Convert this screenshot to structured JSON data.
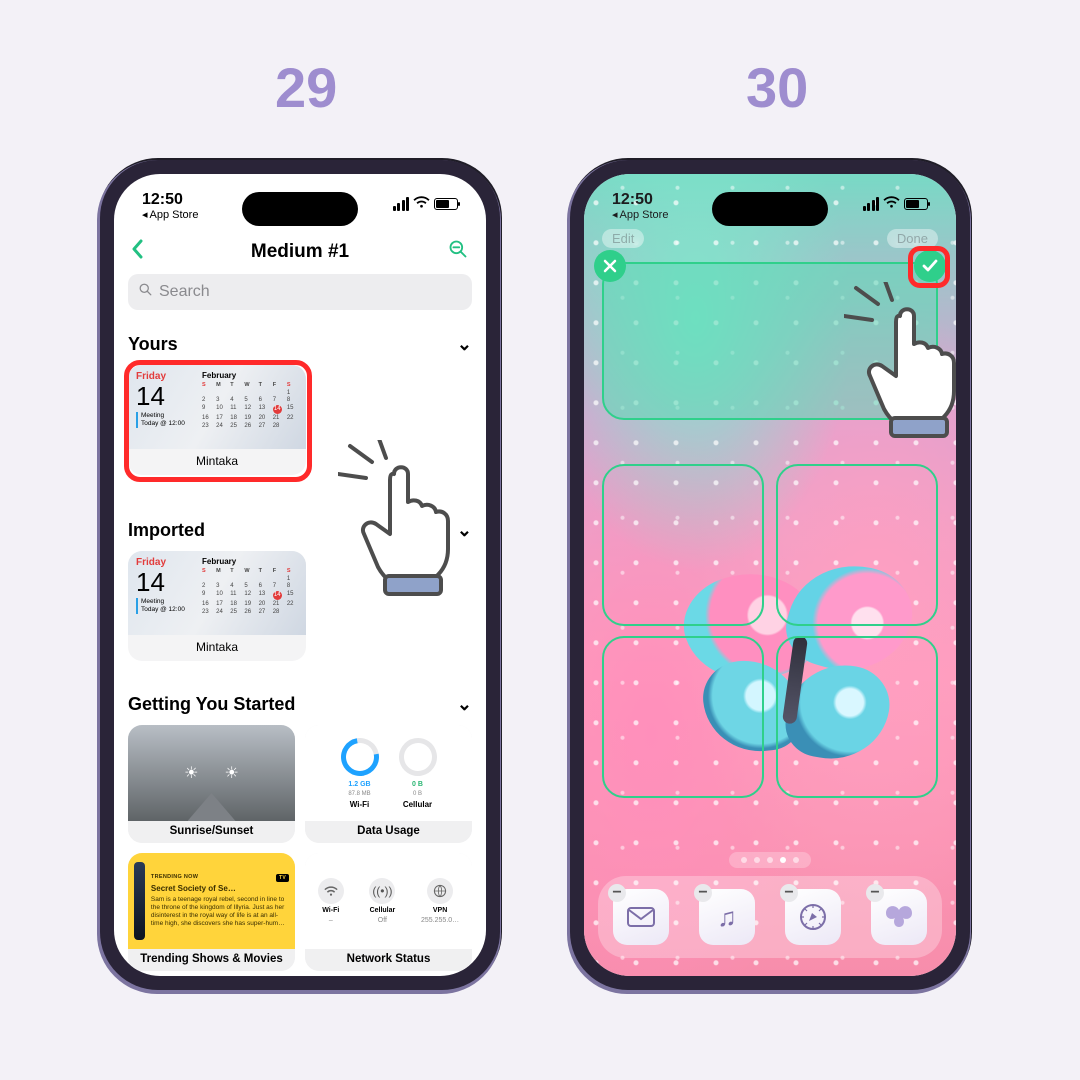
{
  "steps": {
    "left": "29",
    "right": "30"
  },
  "status": {
    "time": "12:50",
    "back_label": "App Store"
  },
  "left_screen": {
    "nav_title": "Medium #1",
    "search_placeholder": "Search",
    "sections": {
      "yours": "Yours",
      "imported": "Imported",
      "started": "Getting You Started"
    },
    "widget": {
      "day_name": "Friday",
      "month": "February",
      "date": "14",
      "event_title": "Meeting",
      "event_time": "Today @ 12:00",
      "label": "Mintaka",
      "dow": [
        "S",
        "M",
        "T",
        "W",
        "T",
        "F",
        "S"
      ],
      "days": [
        "",
        "",
        "",
        "",
        "",
        "",
        "1",
        "2",
        "3",
        "4",
        "5",
        "6",
        "7",
        "8",
        "9",
        "10",
        "11",
        "12",
        "13",
        "14",
        "15",
        "16",
        "17",
        "18",
        "19",
        "20",
        "21",
        "22",
        "23",
        "24",
        "25",
        "26",
        "27",
        "28"
      ]
    },
    "gs": {
      "sun": "Sunrise/Sunset",
      "data": "Data Usage",
      "data_wifi_amount": "1.2 GB",
      "data_wifi_sub": "87.8 MB",
      "data_wifi_label": "Wi-Fi",
      "data_cell_amount": "0 B",
      "data_cell_sub": "0 B",
      "data_cell_label": "Cellular",
      "tv": "Trending Shows & Movies",
      "tv_tag": "TRENDING NOW",
      "tv_badge": "TV",
      "tv_title": "Secret Society of Se…",
      "tv_plot": "Sam is a teenage royal rebel, second in line to the throne of the kingdom of Illyria. Just as her disinterest in the royal way of life is at an all-time high, she discovers she has super-hum…",
      "net": "Network Status",
      "net_items": [
        {
          "label": "Wi-Fi",
          "value": "–"
        },
        {
          "label": "Cellular",
          "value": "Off"
        },
        {
          "label": "VPN",
          "value": "255.255.0…"
        }
      ]
    }
  },
  "right_screen": {
    "edit_label": "Edit",
    "done_label": "Done"
  }
}
